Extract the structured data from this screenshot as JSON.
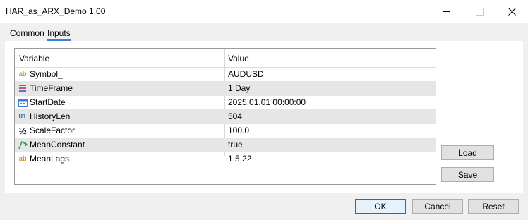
{
  "window": {
    "title": "HAR_as_ARX_Demo 1.00"
  },
  "tabs": [
    {
      "label": "Common"
    },
    {
      "label": "Inputs"
    }
  ],
  "table": {
    "headers": {
      "variable": "Variable",
      "value": "Value"
    },
    "rows": [
      {
        "icon": "ab-string-icon",
        "icon_text": "ab",
        "name": "Symbol_",
        "value": "AUDUSD"
      },
      {
        "icon": "timeframe-icon",
        "icon_text": "",
        "name": "TimeFrame",
        "value": "1 Day"
      },
      {
        "icon": "calendar-icon",
        "icon_text": "",
        "name": "StartDate",
        "value": "2025.01.01 00:00:00"
      },
      {
        "icon": "integer-icon",
        "icon_text": "01",
        "name": "HistoryLen",
        "value": "504"
      },
      {
        "icon": "fraction-icon",
        "icon_text": "½",
        "name": "ScaleFactor",
        "value": "100.0"
      },
      {
        "icon": "boolean-icon",
        "icon_text": "",
        "name": "MeanConstant",
        "value": "true"
      },
      {
        "icon": "ab-string-icon",
        "icon_text": "ab",
        "name": "MeanLags",
        "value": "1,5,22"
      }
    ]
  },
  "side_buttons": {
    "load": "Load",
    "save": "Save"
  },
  "footer_buttons": {
    "ok": "OK",
    "cancel": "Cancel",
    "reset": "Reset"
  },
  "colors": {
    "accent": "#3c7fd6",
    "alt_row": "#e6e6e6"
  }
}
